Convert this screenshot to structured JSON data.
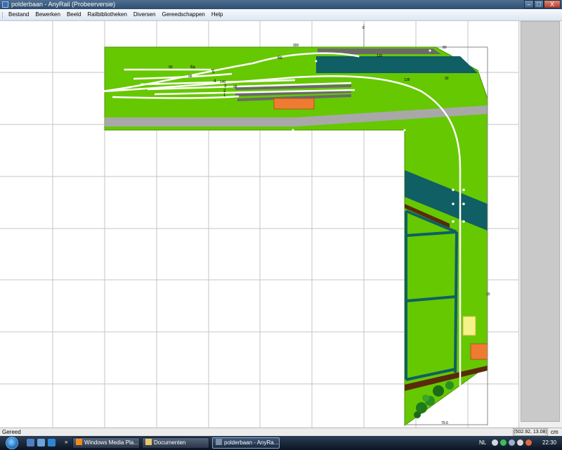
{
  "window": {
    "title": "polderbaan - AnyRail (Probeerversie)",
    "buttons": {
      "minimize": "–",
      "maximize": "□",
      "close": "X"
    }
  },
  "menu": [
    "Bestand",
    "Bewerken",
    "Beeld",
    "Railbibliotheken",
    "Diversen",
    "Gereedschappen",
    "Help"
  ],
  "layout": {
    "labels": {
      "top_length": "300",
      "dim_right_top": "80",
      "dim_track_a": "120",
      "dim_track_b": "138",
      "dim_track_c": "30",
      "track_6b": "6b",
      "track_6a": "6a",
      "track_5": "5",
      "track_4": "4",
      "track_3": "3",
      "track_2": "2",
      "track_1": "1",
      "dim_90": "90",
      "dim_96": "96",
      "dim_140": "140",
      "dim_98": "98",
      "dim_15": "15",
      "dim_bottom": "79.6",
      "ruler_top": "8"
    },
    "colors": {
      "baseboard": "#66c800",
      "water": "#0f5f64",
      "road": "#a8a8a8",
      "track": "#ffffff",
      "siding": "#6a6a6a",
      "building_orange": "#ef7b33",
      "building_yellow": "#f6f28a",
      "soil": "#5a2a0c",
      "tree": "#1f7a1a",
      "grid": "#c6c6c6"
    }
  },
  "statusbar": {
    "text": "Gereed",
    "coordinates": "(502.92, 13.08)",
    "unit": "cm"
  },
  "taskbar": {
    "expand": "»",
    "tasks": [
      "Windows Media Pla...",
      "Documenten",
      "polderbaan - AnyRa..."
    ],
    "language": "NL",
    "clock": "22:30"
  }
}
